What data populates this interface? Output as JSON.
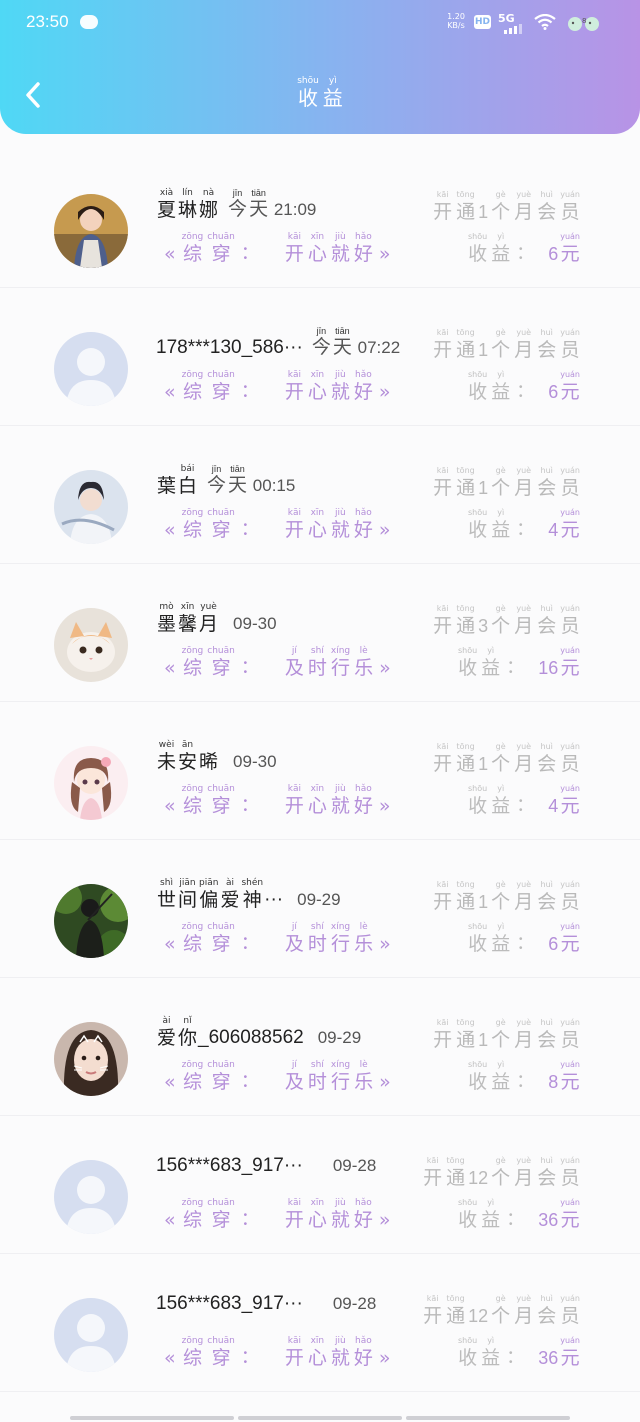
{
  "status_bar": {
    "time": "23:50",
    "net_speed": "1.20",
    "net_unit": "KB/s",
    "hd": "HD",
    "net": "5G"
  },
  "header": {
    "title": [
      {
        "py": "shōu",
        "ch": "收"
      },
      {
        "py": "yì",
        "ch": "益"
      }
    ]
  },
  "items": [
    {
      "name_parts": [
        {
          "py": "xià",
          "ch": "夏"
        },
        {
          "py": "lín",
          "ch": "琳"
        },
        {
          "py": "nà",
          "ch": "娜"
        }
      ],
      "time_parts": [
        {
          "py": "jīn",
          "ch": "今"
        },
        {
          "py": "tiān",
          "ch": "天"
        }
      ],
      "time_text": "21:09",
      "vip_count": "1",
      "origin_parts": [
        {
          "py": "kāi",
          "ch": "开"
        },
        {
          "py": "xīn",
          "ch": "心"
        },
        {
          "py": "jiù",
          "ch": "就"
        },
        {
          "py": "hǎo",
          "ch": "好"
        }
      ],
      "amount": "6",
      "avatar": "photo-girl"
    },
    {
      "name_text": "178***130_586···",
      "time_parts": [
        {
          "py": "jīn",
          "ch": "今"
        },
        {
          "py": "tiān",
          "ch": "天"
        }
      ],
      "time_text": "07:22",
      "vip_count": "1",
      "origin_parts": [
        {
          "py": "kāi",
          "ch": "开"
        },
        {
          "py": "xīn",
          "ch": "心"
        },
        {
          "py": "jiù",
          "ch": "就"
        },
        {
          "py": "hǎo",
          "ch": "好"
        }
      ],
      "amount": "6",
      "avatar": "default"
    },
    {
      "name_parts": [
        {
          "py": "",
          "ch": "葉"
        },
        {
          "py": "bái",
          "ch": "白"
        }
      ],
      "time_parts": [
        {
          "py": "jīn",
          "ch": "今"
        },
        {
          "py": "tiān",
          "ch": "天"
        }
      ],
      "time_text": "00:15",
      "vip_count": "1",
      "origin_parts": [
        {
          "py": "kāi",
          "ch": "开"
        },
        {
          "py": "xīn",
          "ch": "心"
        },
        {
          "py": "jiù",
          "ch": "就"
        },
        {
          "py": "hǎo",
          "ch": "好"
        }
      ],
      "amount": "4",
      "avatar": "photo-costume"
    },
    {
      "name_parts": [
        {
          "py": "mò",
          "ch": "墨"
        },
        {
          "py": "xīn",
          "ch": "馨"
        },
        {
          "py": "yuè",
          "ch": "月"
        }
      ],
      "time_text": "09-30",
      "vip_count": "3",
      "origin_parts": [
        {
          "py": "jí",
          "ch": "及"
        },
        {
          "py": "shí",
          "ch": "时"
        },
        {
          "py": "xíng",
          "ch": "行"
        },
        {
          "py": "lè",
          "ch": "乐"
        }
      ],
      "amount": "16",
      "avatar": "photo-cat"
    },
    {
      "name_parts": [
        {
          "py": "wèi",
          "ch": "未"
        },
        {
          "py": "ān",
          "ch": "安"
        },
        {
          "py": "",
          "ch": "晞"
        }
      ],
      "time_text": "09-30",
      "vip_count": "1",
      "origin_parts": [
        {
          "py": "kāi",
          "ch": "开"
        },
        {
          "py": "xīn",
          "ch": "心"
        },
        {
          "py": "jiù",
          "ch": "就"
        },
        {
          "py": "hǎo",
          "ch": "好"
        }
      ],
      "amount": "4",
      "avatar": "photo-anime"
    },
    {
      "name_parts": [
        {
          "py": "shì",
          "ch": "世"
        },
        {
          "py": "jiān",
          "ch": "间"
        },
        {
          "py": "piān",
          "ch": "偏"
        },
        {
          "py": "ài",
          "ch": "爱"
        },
        {
          "py": "shén",
          "ch": "神"
        }
      ],
      "name_suffix": "···",
      "time_text": "09-29",
      "vip_count": "1",
      "origin_parts": [
        {
          "py": "jí",
          "ch": "及"
        },
        {
          "py": "shí",
          "ch": "时"
        },
        {
          "py": "xíng",
          "ch": "行"
        },
        {
          "py": "lè",
          "ch": "乐"
        }
      ],
      "amount": "6",
      "avatar": "photo-forest"
    },
    {
      "name_parts": [
        {
          "py": "ài",
          "ch": "爱"
        },
        {
          "py": "nǐ",
          "ch": "你"
        }
      ],
      "name_suffix": "_606088562",
      "time_text": "09-29",
      "vip_count": "1",
      "origin_parts": [
        {
          "py": "jí",
          "ch": "及"
        },
        {
          "py": "shí",
          "ch": "时"
        },
        {
          "py": "xíng",
          "ch": "行"
        },
        {
          "py": "lè",
          "ch": "乐"
        }
      ],
      "amount": "8",
      "avatar": "photo-face"
    },
    {
      "name_text": "156***683_917···",
      "time_text": "09-28",
      "vip_count": "12",
      "origin_parts": [
        {
          "py": "kāi",
          "ch": "开"
        },
        {
          "py": "xīn",
          "ch": "心"
        },
        {
          "py": "jiù",
          "ch": "就"
        },
        {
          "py": "hǎo",
          "ch": "好"
        }
      ],
      "amount": "36",
      "avatar": "default"
    },
    {
      "name_text": "156***683_917···",
      "time_text": "09-28",
      "vip_count": "12",
      "origin_parts": [
        {
          "py": "kāi",
          "ch": "开"
        },
        {
          "py": "xīn",
          "ch": "心"
        },
        {
          "py": "jiù",
          "ch": "就"
        },
        {
          "py": "hǎo",
          "ch": "好"
        }
      ],
      "amount": "36",
      "avatar": "default"
    }
  ],
  "labels": {
    "open": [
      {
        "py": "kāi",
        "ch": "开"
      },
      {
        "py": "tōng",
        "ch": "通"
      }
    ],
    "months": [
      {
        "py": "gè",
        "ch": "个"
      },
      {
        "py": "yuè",
        "ch": "月"
      },
      {
        "py": "huì",
        "ch": "会"
      },
      {
        "py": "yuán",
        "ch": "员"
      }
    ],
    "origin": [
      {
        "py": "zōng",
        "ch": "综"
      },
      {
        "py": "chuān",
        "ch": "穿"
      }
    ],
    "earn": [
      {
        "py": "shōu",
        "ch": "收"
      },
      {
        "py": "yì",
        "ch": "益"
      }
    ],
    "yuan": [
      {
        "py": "yuán",
        "ch": "元"
      }
    ],
    "quote_open": "«",
    "quote_close": "»",
    "colon": "："
  },
  "colors": {
    "header_left": "#4fd8f5",
    "header_right": "#b893e6",
    "accent": "#b48fd9",
    "muted": "#b9b9b9"
  },
  "icons": {
    "back": "chevron-left-icon",
    "avatar_default": "default-avatar-icon"
  }
}
